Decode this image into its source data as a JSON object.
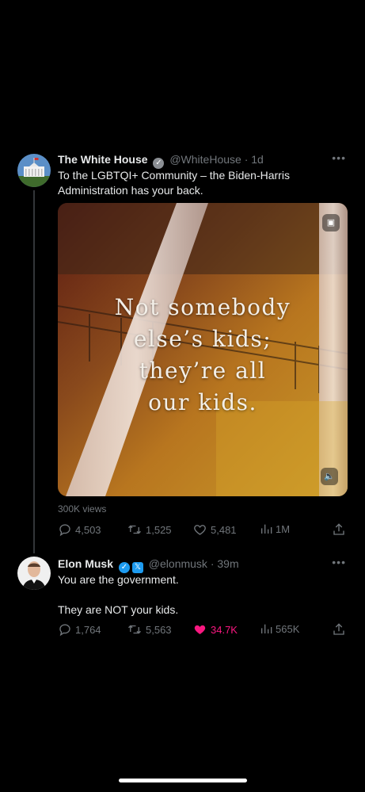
{
  "tweets": [
    {
      "author": "The White House",
      "handle": "@WhiteHouse",
      "time": "· 1d",
      "text_line1": "To the LGBTQI+ Community – the Biden-Harris",
      "text_line2": "Administration has your back.",
      "media_quote": [
        "Not somebody",
        "else’s kids;",
        "they’re all",
        "our kids."
      ],
      "views": "300K views",
      "replies": "4,503",
      "reposts": "1,525",
      "likes": "5,481",
      "analytics": "1M"
    },
    {
      "author": "Elon Musk",
      "handle": "@elonmusk",
      "time": "· 39m",
      "text_line1": "You are the government.",
      "text_line2": "They are NOT your kids.",
      "replies": "1,764",
      "reposts": "5,563",
      "likes": "34.7K",
      "analytics": "565K"
    }
  ],
  "colors": {
    "like_active": "#f91880",
    "verified_blue": "#1d9bf0",
    "muted_text": "#71767b"
  },
  "icons": [
    "reply-icon",
    "repost-icon",
    "like-icon",
    "analytics-icon",
    "share-icon",
    "more-icon",
    "verified-icon",
    "mute-icon"
  ]
}
